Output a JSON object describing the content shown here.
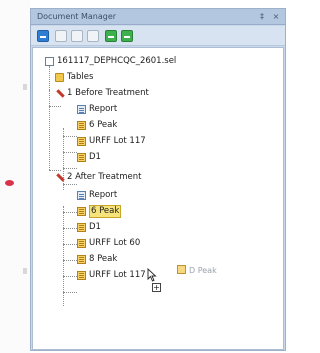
{
  "panel": {
    "title": "Document Manager",
    "pin_symbol": "‡",
    "close_symbol": "×"
  },
  "toolbar": {
    "buttons": [
      {
        "icon": "expand-icon",
        "color": "#2e7fd4"
      },
      {
        "icon": "new-document-icon",
        "color": "#f1f4f7"
      },
      {
        "icon": "copy-icon",
        "color": "#f1f4f7"
      },
      {
        "icon": "paste-icon",
        "color": "#f1f4f7"
      },
      {
        "icon": "add-icon",
        "color": "#3fb04e"
      },
      {
        "icon": "remove-icon",
        "color": "#3fb04e"
      }
    ]
  },
  "tree": {
    "root": "161117_DEPHCQC_2601.sel",
    "tables": "Tables",
    "group1": {
      "label": "1 Before Treatment",
      "items": [
        "Report",
        "6 Peak",
        "URFF Lot 117",
        "D1"
      ]
    },
    "group2": {
      "label": "2 After Treatment",
      "items": [
        "Report",
        "6 Peak",
        "D1",
        "URFF Lot 60",
        "8 Peak",
        "URFF Lot 117"
      ]
    }
  },
  "drag": {
    "label": "D Peak",
    "cursor_symbol": "+"
  },
  "colors": {
    "panel_bg": "#c9d9ed",
    "selection": "#f6e37a",
    "marker": "#d8344a"
  }
}
